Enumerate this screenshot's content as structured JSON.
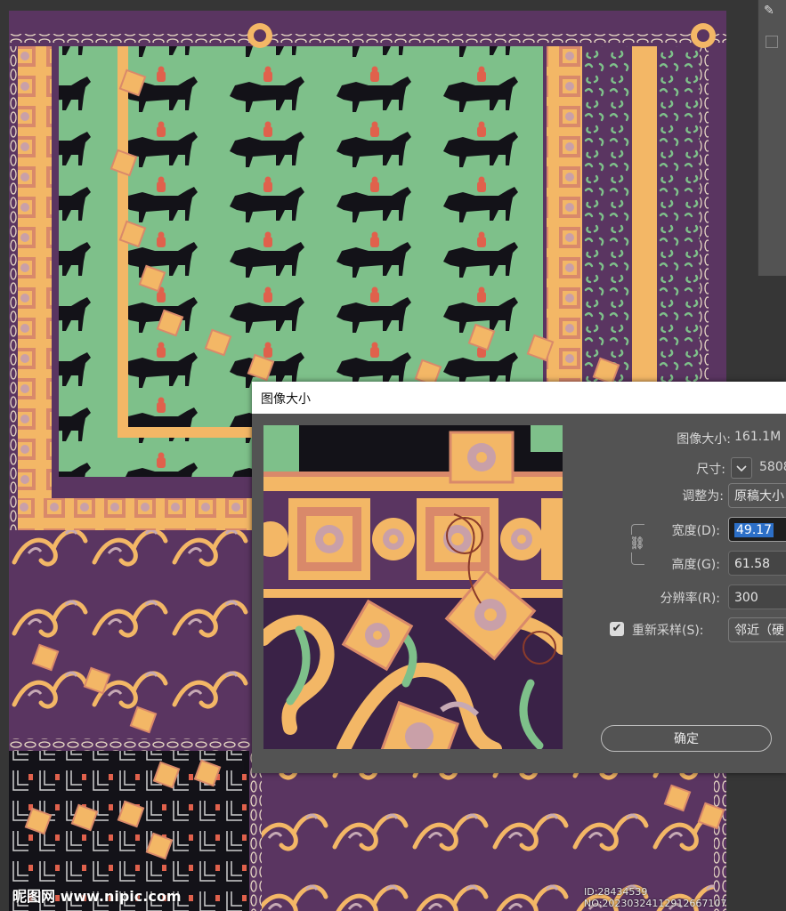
{
  "dialog": {
    "title": "图像大小",
    "image_size_label": "图像大小:",
    "image_size_value": "161.1M",
    "dimensions_label": "尺寸:",
    "dimensions_value": "5808",
    "fit_to_label": "调整为:",
    "fit_to_value": "原稿大小",
    "width_label": "宽度(D):",
    "width_value": "49.17",
    "height_label": "高度(G):",
    "height_value": "61.58",
    "resolution_label": "分辨率(R):",
    "resolution_value": "300",
    "resample_label": "重新采样(S):",
    "resample_checked": true,
    "resample_value": "邻近（硬",
    "ok_label": "确定"
  },
  "watermark": {
    "site": "昵图网 www.nipic.com",
    "id": "ID:28434539 NO:20230324112912667107"
  },
  "colors": {
    "purple": "#5a3561",
    "dark_purple": "#3a2247",
    "green": "#7ec08a",
    "orange": "#f3b766",
    "horse_black": "#131218",
    "rider_red": "#e0614c",
    "dialog_bg": "#535353",
    "accent_blue": "#2c6fc7"
  },
  "icons": {
    "chevron": "chevron-down-icon",
    "link": "chain-link-icon",
    "check": "checkmark-icon"
  }
}
